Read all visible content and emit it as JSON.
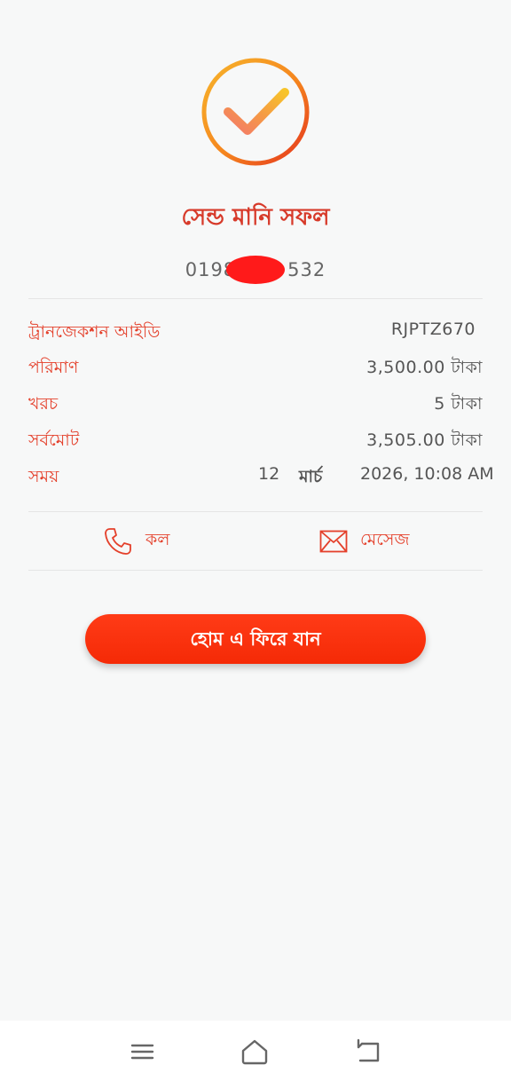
{
  "status": {
    "title": "সেন্ড মানি সফল",
    "phone_prefix": "0198",
    "phone_suffix": "532"
  },
  "details": [
    {
      "label": "ট্রানজেকশন আইডি",
      "value": "RJPTZ670"
    },
    {
      "label": "পরিমাণ",
      "value": "3,500.00 টাকা"
    },
    {
      "label": "খরচ",
      "value": "5 টাকা"
    },
    {
      "label": "সর্বমোট",
      "value": "3,505.00 টাকা"
    }
  ],
  "time": {
    "label": "সময়",
    "day": "12",
    "month": "মার্চ",
    "rest": "2026, 10:08 AM"
  },
  "actions": {
    "call_label": "কল",
    "message_label": "মেসেজ"
  },
  "home_button_label": "হোম এ ফিরে যান",
  "icons": {
    "success": "check-circle-icon",
    "call": "phone-icon",
    "message": "envelope-icon",
    "nav_menu": "menu-icon",
    "nav_home": "home-icon",
    "nav_back": "back-icon"
  },
  "colors": {
    "accent": "#e4402b",
    "title": "#d73a2a",
    "button": "#f52a06",
    "redaction": "#ff1a1a"
  }
}
